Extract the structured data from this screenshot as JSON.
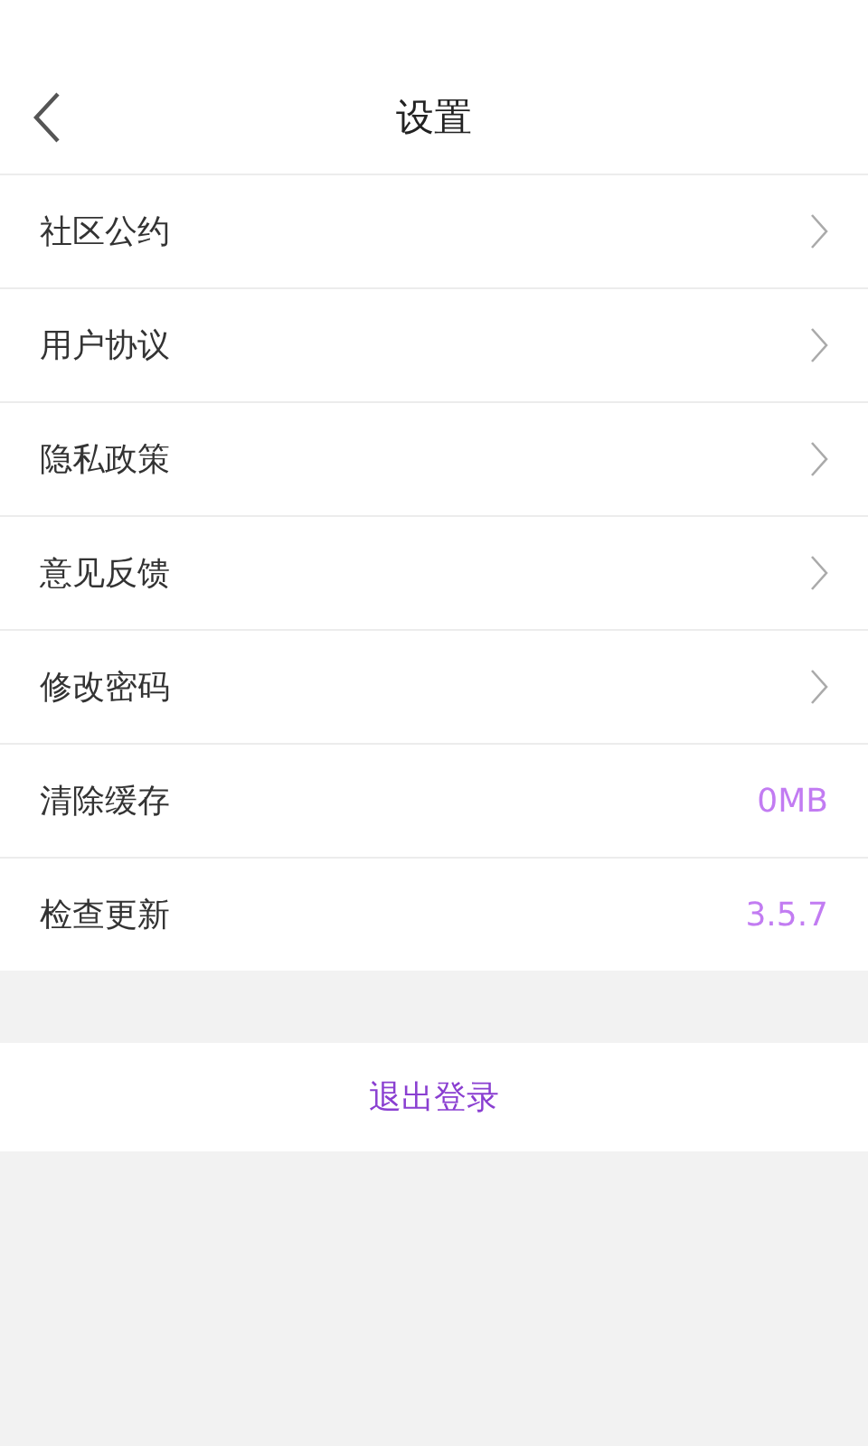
{
  "header": {
    "title": "设置"
  },
  "rows": [
    {
      "label": "社区公约",
      "kind": "link"
    },
    {
      "label": "用户协议",
      "kind": "link"
    },
    {
      "label": "隐私政策",
      "kind": "link"
    },
    {
      "label": "意见反馈",
      "kind": "link"
    },
    {
      "label": "修改密码",
      "kind": "link"
    },
    {
      "label": "清除缓存",
      "kind": "value",
      "value": "0MB"
    },
    {
      "label": "检查更新",
      "kind": "value",
      "value": "3.5.7"
    }
  ],
  "logout": {
    "label": "退出登录"
  }
}
